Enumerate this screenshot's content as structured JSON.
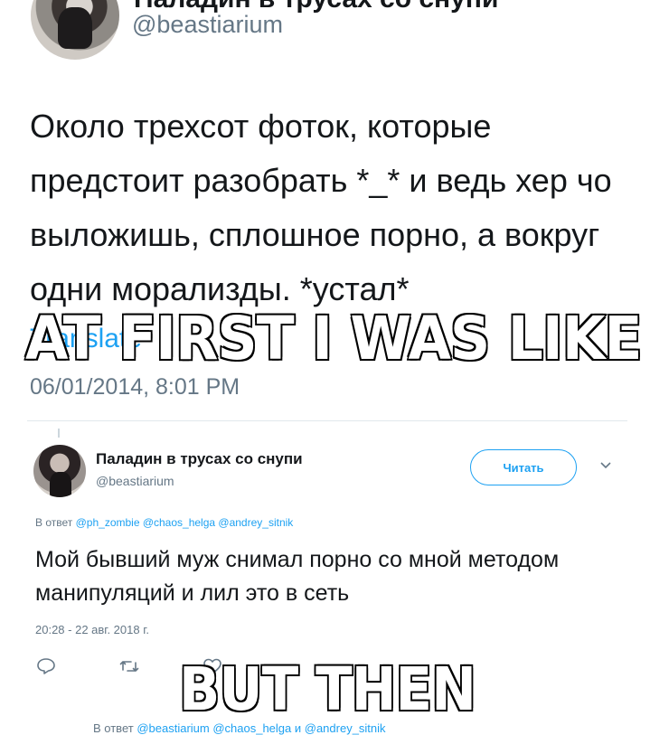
{
  "top_tweet": {
    "name_cut": "Паладин в трусах со снупи",
    "handle": "@beastiarium",
    "text": "Около трехсот фоток, которые предстоит разобрать *_* и ведь хер чо выложишь, сплошное порно, а вокруг одни морализды. *устал*",
    "translate_label": "Translate",
    "timestamp": "06/01/2014, 8:01 PM"
  },
  "second_tweet": {
    "name": "Паладин в трусах со снупи",
    "handle": "@beastiarium",
    "follow_label": "Читать",
    "reply_prefix": "В ответ",
    "reply_mentions": "@ph_zombie @chaos_helga @andrey_sitnik",
    "text": "Мой бывший муж снимал порно со мной методом манипуляций и лил это в сеть",
    "timestamp": "20:28 - 22 авг. 2018 г."
  },
  "bottom_reply": {
    "prefix": "В ответ",
    "mentions": "@beastiarium @chaos_helga и @andrey_sitnik"
  },
  "meme": {
    "top_caption": "AT FIRST I WAS LIKE",
    "bottom_caption": "BUT THEN"
  },
  "icons": [
    "reply-icon",
    "retweet-icon",
    "like-icon",
    "chevron-down-icon"
  ],
  "colors": {
    "link": "#1da1f2",
    "secondary": "#657786",
    "text": "#14171a"
  }
}
